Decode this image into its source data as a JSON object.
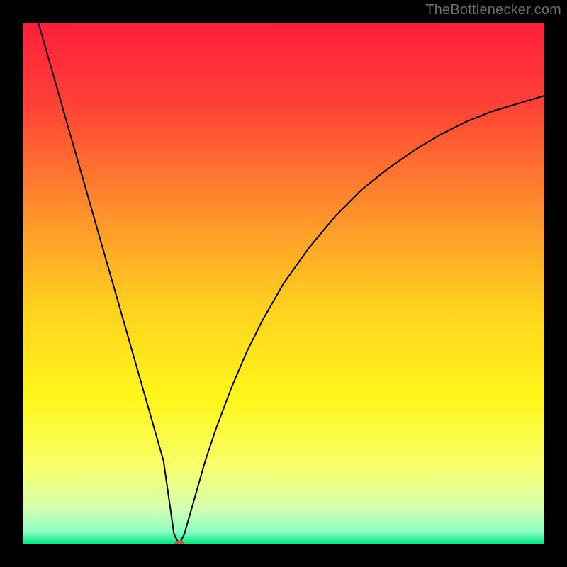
{
  "watermark": "TheBottlenecker.com",
  "chart_data": {
    "type": "line",
    "title": "",
    "xlabel": "",
    "ylabel": "",
    "xlim": [
      0,
      100
    ],
    "ylim": [
      0,
      100
    ],
    "x": [
      3,
      5,
      7,
      9,
      11,
      13,
      15,
      17,
      19,
      21,
      23,
      25,
      27,
      28,
      29,
      30,
      31,
      33,
      35,
      37,
      40,
      43,
      46,
      50,
      55,
      60,
      65,
      70,
      75,
      80,
      85,
      90,
      95,
      100
    ],
    "y": [
      100,
      93,
      86,
      79,
      72,
      65,
      58,
      51,
      44,
      37,
      30,
      23,
      16,
      9,
      2,
      0,
      2,
      9,
      16,
      22,
      30,
      37,
      43,
      50,
      57,
      63,
      68,
      72,
      75.5,
      78.5,
      81,
      83,
      84.5,
      86
    ],
    "marker": {
      "x": 30,
      "y": 0
    },
    "gradient_stops": [
      {
        "offset": 0,
        "color": "#ff1f3a"
      },
      {
        "offset": 0.15,
        "color": "#ff3f37"
      },
      {
        "offset": 0.35,
        "color": "#ff8b2d"
      },
      {
        "offset": 0.55,
        "color": "#ffd21f"
      },
      {
        "offset": 0.72,
        "color": "#fff71a"
      },
      {
        "offset": 0.85,
        "color": "#f7ff6a"
      },
      {
        "offset": 0.93,
        "color": "#d6ffb0"
      },
      {
        "offset": 0.975,
        "color": "#8fffc4"
      },
      {
        "offset": 1.0,
        "color": "#00e37e"
      }
    ]
  },
  "marker_color": "#b75a4e",
  "curve_color": "#000000",
  "curve_width": 2
}
